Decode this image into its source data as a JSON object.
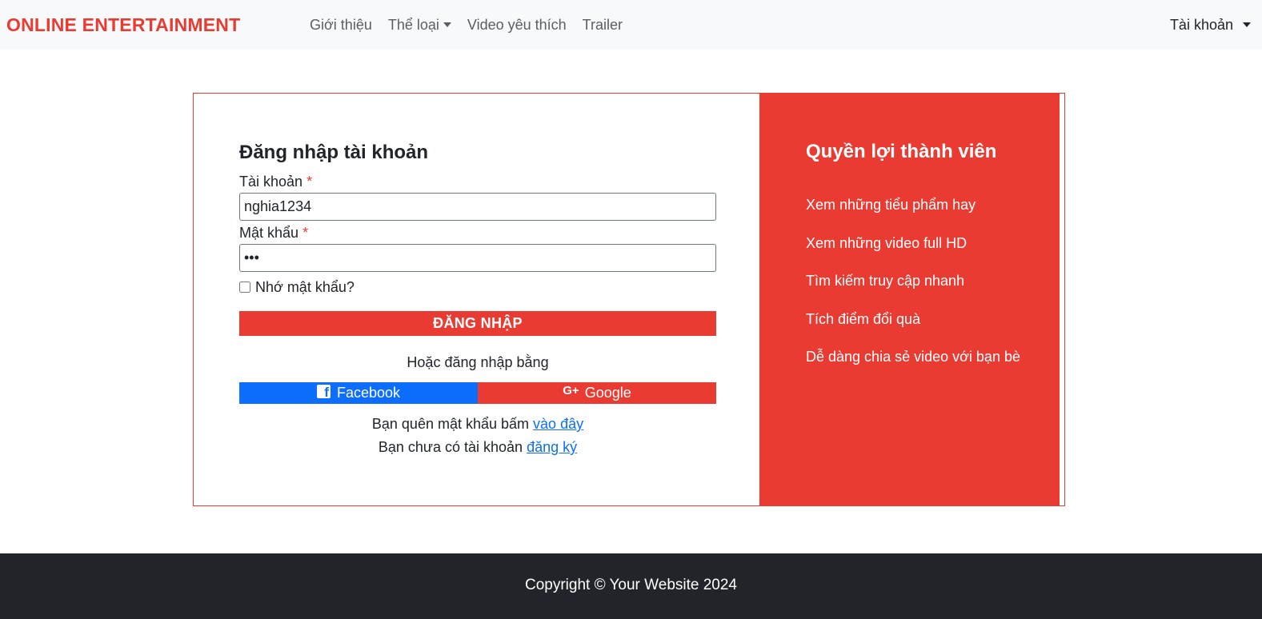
{
  "brand": "ONLINE ENTERTAINMENT",
  "nav": {
    "items": [
      "Giới thiệu",
      "Thể loại",
      "Video yêu thích",
      "Trailer"
    ],
    "account": "Tài khoản"
  },
  "login": {
    "title": "Đăng nhập tài khoản",
    "username_label": "Tài khoản",
    "password_label": "Mật khẩu",
    "required_mark": "*",
    "username_value": "nghia1234",
    "password_value": "•••",
    "remember_label": "Nhớ mật khẩu?",
    "remember_checked": false,
    "submit_label": "ĐĂNG NHẬP",
    "or_text": "Hoặc đăng nhập bằng",
    "facebook_label": "Facebook",
    "google_label": "Google",
    "google_icon_text": "G+",
    "forgot_text": "Bạn quên mật khẩu bấm",
    "forgot_link": "vào đây",
    "register_text": "Bạn chưa có tài khoản",
    "register_link": "đăng ký"
  },
  "benefits": {
    "title": "Quyền lợi thành viên",
    "items": [
      "Xem những tiểu phẩm hay",
      "Xem những video full HD",
      "Tìm kiếm truy cập nhanh",
      "Tích điểm đổi quà",
      "Dễ dàng chia sẻ video với bạn bè"
    ]
  },
  "footer": {
    "text": "Copyright © Your Website 2024"
  },
  "colors": {
    "accent": "#e93b32",
    "facebook": "#0d6efd",
    "footer_bg": "#212529",
    "navbar_bg": "#f8f9fa"
  }
}
